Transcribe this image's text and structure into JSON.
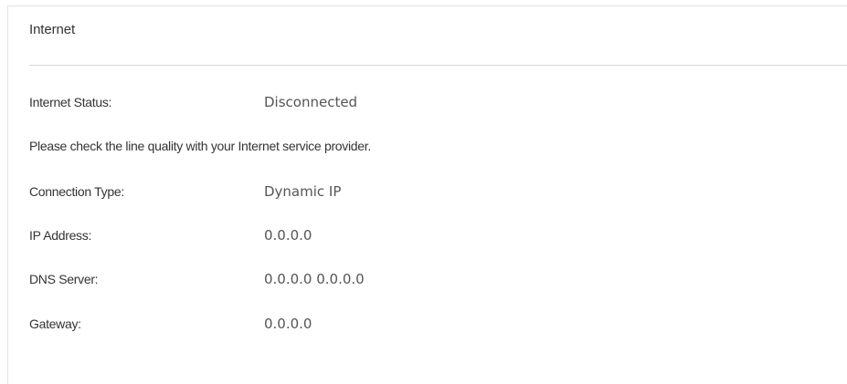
{
  "panel": {
    "title": "Internet"
  },
  "status": {
    "label": "Internet Status:",
    "value": "Disconnected"
  },
  "message": "Please check the line quality with your Internet service provider.",
  "details": {
    "connection_type": {
      "label": "Connection Type:",
      "value": "Dynamic IP"
    },
    "ip_address": {
      "label": "IP Address:",
      "value": "0.0.0.0"
    },
    "dns_server": {
      "label": "DNS Server:",
      "value": "0.0.0.0 0.0.0.0"
    },
    "gateway": {
      "label": "Gateway:",
      "value": "0.0.0.0"
    }
  }
}
